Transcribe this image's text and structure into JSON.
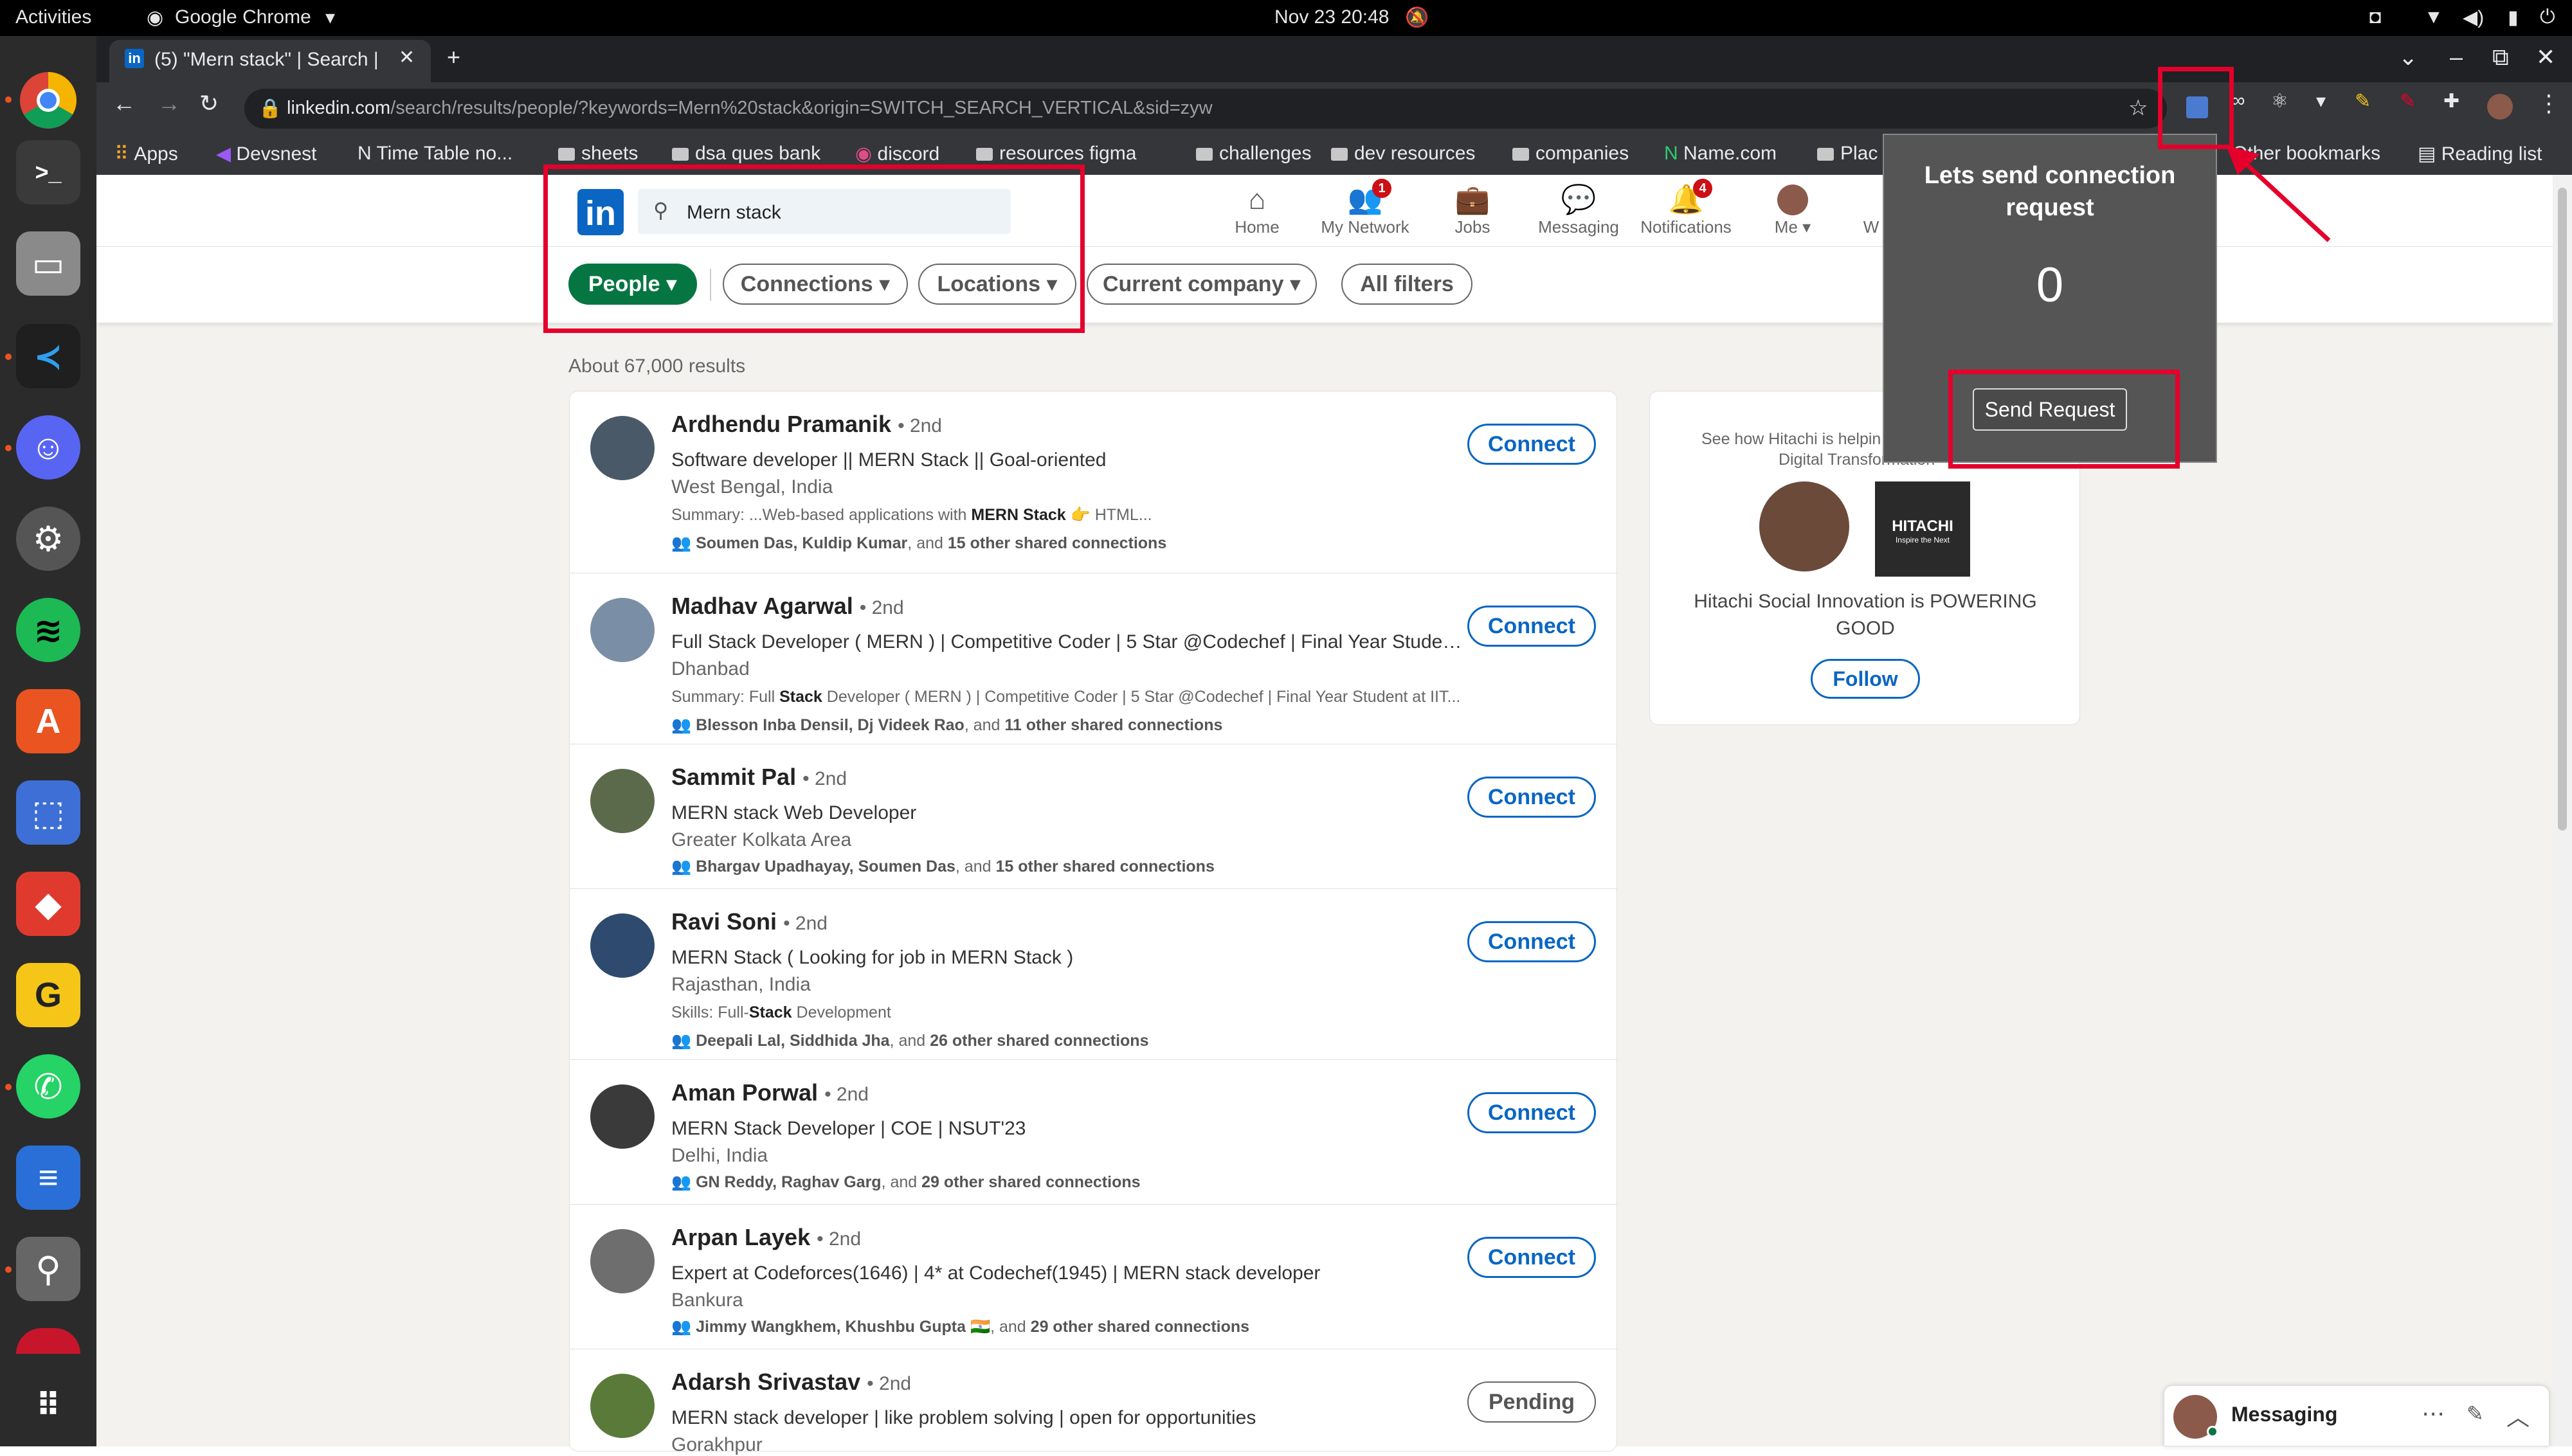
{
  "system": {
    "activities": "Activities",
    "app_name": "Google Chrome",
    "clock": "Nov 23  20:48"
  },
  "browser": {
    "tab_title": "(5) \"Mern stack\" | Search |",
    "url_host": "linkedin.com",
    "url_path": "/search/results/people/?keywords=Mern%20stack&origin=SWITCH_SEARCH_VERTICAL&sid=zyw",
    "bookmarks": [
      "Apps",
      "Devsnest",
      "Time Table no...",
      "sheets",
      "dsa ques bank",
      "discord",
      "resources figma",
      "challenges",
      "dev resources",
      "companies",
      "Name.com",
      "Plac"
    ],
    "other_bookmarks": "Other bookmarks",
    "reading_list": "Reading list"
  },
  "linkedin": {
    "logo": "in",
    "search_value": "Mern stack",
    "nav": [
      {
        "label": "Home",
        "icon": "home-icon",
        "badge": ""
      },
      {
        "label": "My Network",
        "icon": "network-icon",
        "badge": "1"
      },
      {
        "label": "Jobs",
        "icon": "jobs-icon",
        "badge": ""
      },
      {
        "label": "Messaging",
        "icon": "messaging-icon",
        "badge": ""
      },
      {
        "label": "Notifications",
        "icon": "bell-icon",
        "badge": "4"
      },
      {
        "label": "Me",
        "icon": "avatar",
        "badge": ""
      }
    ],
    "nav_cut": "W",
    "filters": [
      "People",
      "Connections",
      "Locations",
      "Current company",
      "All filters"
    ],
    "results_count": "About 67,000 results"
  },
  "people": [
    {
      "name": "Ardhendu Pramanik",
      "degree": "• 2nd",
      "headline": "Software developer || MERN Stack || Goal-oriented",
      "location": "West Bengal, India",
      "extra_pre": "Summary: ...Web-based applications with ",
      "extra_bold": "MERN Stack",
      "extra_post": " 👉 HTML...",
      "shared_names": "Soumen Das, Kuldip Kumar",
      "shared_mid": ", and ",
      "shared_count": "15 other shared connections",
      "action": "Connect"
    },
    {
      "name": "Madhav Agarwal",
      "degree": "• 2nd",
      "headline": "Full Stack Developer ( MERN ) | Competitive Coder | 5 Star @Codechef | Final Year Student a...",
      "location": "Dhanbad",
      "extra_pre": "Summary: Full ",
      "extra_bold": "Stack",
      "extra_post": " Developer ( MERN ) | Competitive Coder | 5 Star @Codechef | Final Year Student at IIT...",
      "shared_names": "Blesson Inba Densil, Dj Videek Rao",
      "shared_mid": ", and ",
      "shared_count": "11 other shared connections",
      "action": "Connect"
    },
    {
      "name": "Sammit Pal",
      "degree": "• 2nd",
      "headline": "MERN stack Web Developer",
      "location": "Greater Kolkata Area",
      "extra_pre": "",
      "extra_bold": "",
      "extra_post": "",
      "shared_names": "Bhargav Upadhayay, Soumen Das",
      "shared_mid": ", and ",
      "shared_count": "15 other shared connections",
      "action": "Connect"
    },
    {
      "name": "Ravi Soni",
      "degree": "• 2nd",
      "headline": "MERN Stack ( Looking for job in MERN Stack )",
      "location": "Rajasthan, India",
      "extra_pre": "Skills: Full-",
      "extra_bold": "Stack",
      "extra_post": " Development",
      "shared_names": "Deepali Lal, Siddhida Jha",
      "shared_mid": ", and ",
      "shared_count": "26 other shared connections",
      "action": "Connect"
    },
    {
      "name": "Aman Porwal",
      "degree": "• 2nd",
      "headline": "MERN Stack Developer | COE | NSUT'23",
      "location": "Delhi, India",
      "extra_pre": "",
      "extra_bold": "",
      "extra_post": "",
      "shared_names": "GN Reddy, Raghav Garg",
      "shared_mid": ", and ",
      "shared_count": "29 other shared connections",
      "action": "Connect"
    },
    {
      "name": "Arpan Layek",
      "degree": "• 2nd",
      "headline": "Expert at Codeforces(1646) | 4* at Codechef(1945) | MERN stack developer",
      "location": "Bankura",
      "extra_pre": "",
      "extra_bold": "",
      "extra_post": "",
      "shared_names": "Jimmy Wangkhem, Khushbu Gupta 🇮🇳",
      "shared_mid": ", and ",
      "shared_count": "29 other shared connections",
      "action": "Connect"
    },
    {
      "name": "Adarsh Srivastav",
      "degree": "• 2nd",
      "headline": "MERN stack developer | like problem solving | open for opportunities",
      "location": "Gorakhpur",
      "extra_pre": "",
      "extra_bold": "",
      "extra_post": "",
      "shared_names": "",
      "shared_mid": "",
      "shared_count": "",
      "action": "Pending"
    }
  ],
  "ad": {
    "top_text": "See how Hitachi is helpin",
    "top_text2": "Digital Transformation",
    "brand": "HITACHI",
    "brand_sub": "Inspire the Next",
    "headline": "Hitachi Social Innovation is POWERING GOOD",
    "follow": "Follow"
  },
  "extension_popup": {
    "title": "Lets send connection request",
    "count": "0",
    "button": "Send Request"
  },
  "messaging": {
    "label": "Messaging",
    "more": "⋯"
  },
  "colors": {
    "accent": "#0a66c2",
    "people_pill": "#057642",
    "highlight": "#e4002b",
    "popup_bg": "#555555"
  }
}
